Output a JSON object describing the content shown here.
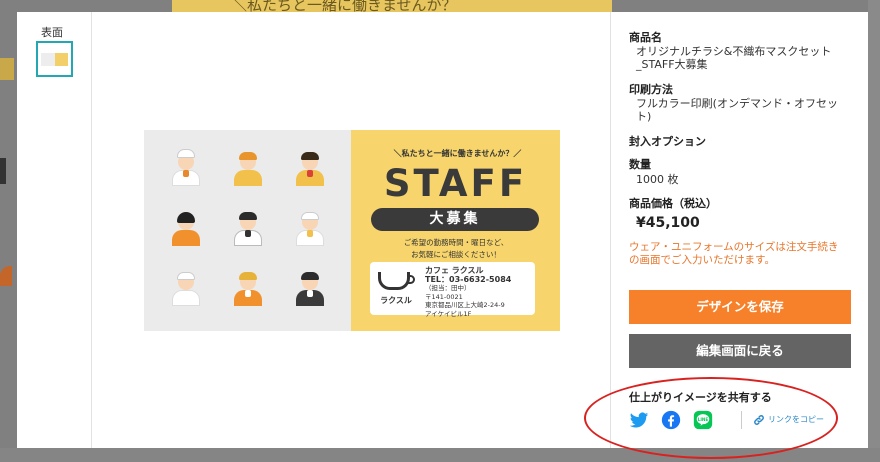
{
  "background": {
    "banner_text": "＼私たちと一緒に働きませんか？"
  },
  "thumbnails": {
    "label": "表面"
  },
  "flyer": {
    "tagline": "＼私たちと一緒に働きませんか？／",
    "title": "STAFF",
    "recruit": "大募集",
    "subtext_line1": "ご希望の勤務時間・曜日など、",
    "subtext_line2": "お気軽にご相談ください！",
    "logo_text": "ラクスル",
    "shop_name": "カフェ ラクスル",
    "tel": "TEL：03-6632-5084",
    "contact": "（担当：田中）",
    "zip": "〒141-0021",
    "address": "東京都品川区上大崎2-24-9",
    "building": "アイケイビル1F"
  },
  "details": {
    "product_name_label": "商品名",
    "product_name_line1": "オリジナルチラシ&不織布マスクセット",
    "product_name_line2": "_STAFF大募集",
    "print_method_label": "印刷方法",
    "print_method_line1": "フルカラー印刷(オンデマンド・オフセッ",
    "print_method_line2": "ト)",
    "enclosure_label": "封入オプション",
    "quantity_label": "数量",
    "quantity_value": "1000 枚",
    "price_label": "商品価格（税込）",
    "price_value": "¥45,100",
    "note_line1": "ウェア・ユニフォームのサイズは注文手続き",
    "note_line2": "の画面でご入力いただけます。",
    "save_button": "デザインを保存",
    "back_button": "編集画面に戻る",
    "share_label": "仕上がりイメージを共有する",
    "copy_link": "リンクをコピー"
  },
  "colors": {
    "accent_orange": "#f6812a",
    "secondary_gray": "#646464",
    "flyer_yellow": "#f7d56c",
    "annotation_red": "#d9221f",
    "twitter_blue": "#1d9bf0",
    "facebook_blue": "#1877f2",
    "line_green": "#06c755"
  },
  "icons": [
    "twitter-icon",
    "facebook-icon",
    "line-icon",
    "link-icon"
  ]
}
